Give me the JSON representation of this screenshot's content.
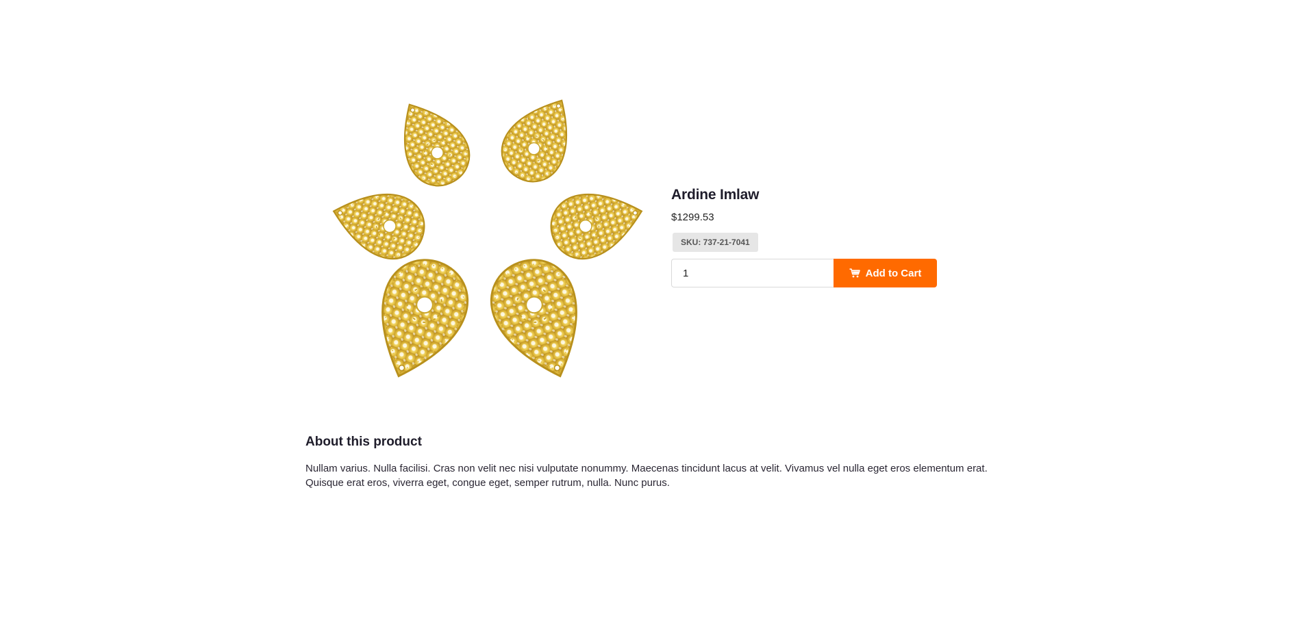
{
  "product": {
    "name": "Ardine Imlaw",
    "price": "$1299.53",
    "sku": "SKU: 737-21-7041",
    "image_icon": "gold-filigree-teardrop-pendants"
  },
  "cart": {
    "quantity": "1",
    "add_label": "Add to Cart",
    "icon": "cart-icon",
    "button_color": "#ff6a00"
  },
  "about": {
    "title": "About this product",
    "description": "Nullam varius. Nulla facilisi. Cras non velit nec nisi vulputate nonummy. Maecenas tincidunt lacus at velit. Vivamus vel nulla eget eros elementum erat. Quisque erat eros, viverra eget, congue eget, semper rutrum, nulla. Nunc purus."
  }
}
